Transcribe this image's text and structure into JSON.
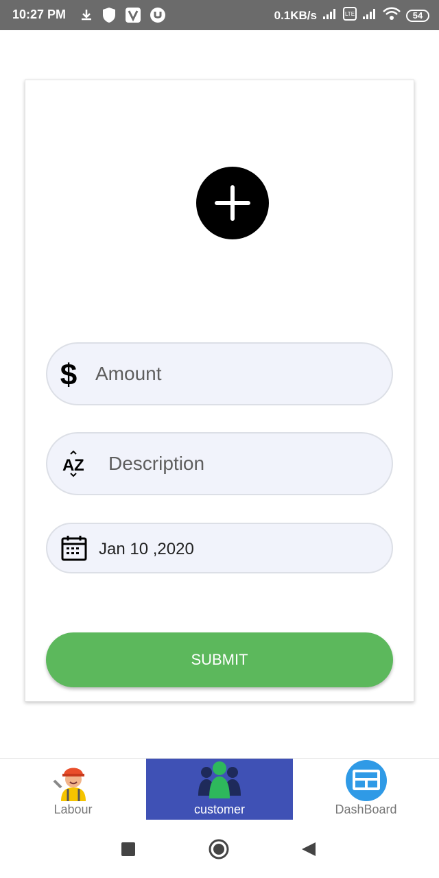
{
  "status_bar": {
    "time": "10:27 PM",
    "network_speed": "0.1KB/s",
    "battery": "54",
    "icons": [
      "download-icon",
      "shield-icon",
      "v-app-icon",
      "torrent-icon",
      "signal-icon",
      "volte-icon",
      "signal-icon",
      "wifi-icon",
      "battery-icon"
    ]
  },
  "form": {
    "add_button_icon": "plus-icon",
    "amount": {
      "placeholder": "Amount",
      "icon": "dollar-icon"
    },
    "description": {
      "placeholder": "Description",
      "icon": "sort-az-icon"
    },
    "date": {
      "value": "Jan 10 ,2020",
      "icon": "calendar-icon"
    },
    "submit_label": "SUBMIT"
  },
  "bottom_nav": {
    "items": [
      {
        "label": "Labour",
        "icon": "worker-icon",
        "active": false
      },
      {
        "label": "customer",
        "icon": "people-icon",
        "active": true
      },
      {
        "label": "DashBoard",
        "icon": "dashboard-icon",
        "active": false
      }
    ]
  },
  "system_nav": {
    "buttons": [
      "recents-button",
      "home-button",
      "back-button"
    ]
  },
  "colors": {
    "status_bar": "#6b6b6b",
    "submit": "#5cb85c",
    "nav_active": "#3f51b5",
    "field_bg": "#f1f3fb"
  }
}
